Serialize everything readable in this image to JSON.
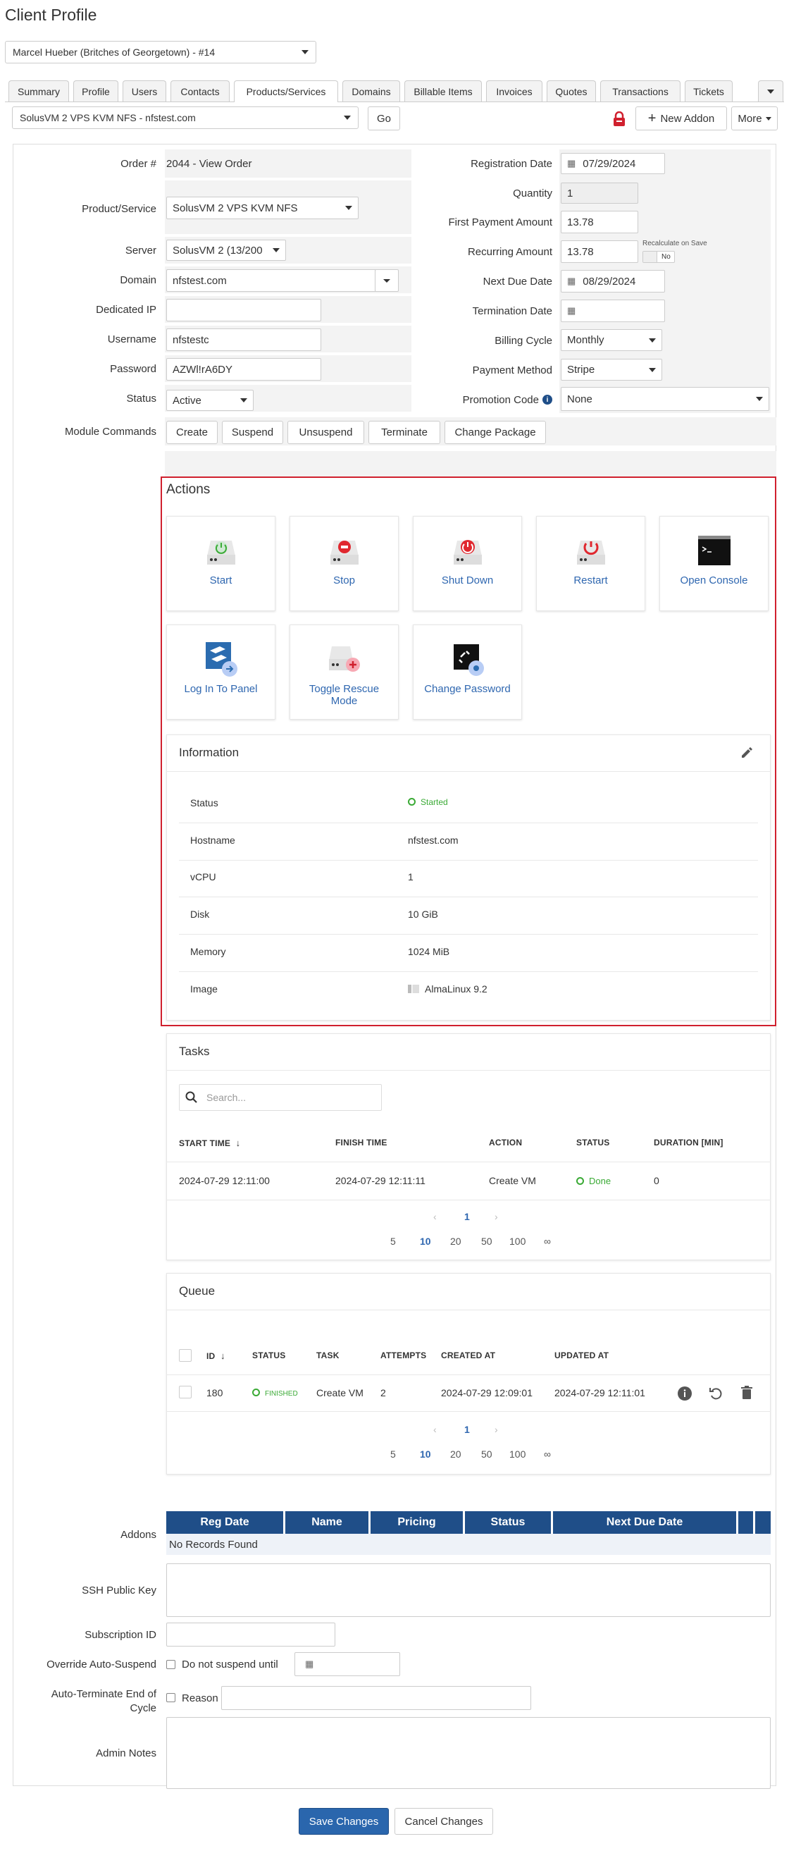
{
  "page_title": "Client Profile",
  "client_select": "Marcel Hueber (Britches of Georgetown) - #14",
  "tabs": [
    "Summary",
    "Profile",
    "Users",
    "Contacts",
    "Products/Services",
    "Domains",
    "Billable Items",
    "Invoices",
    "Quotes",
    "Transactions",
    "Tickets"
  ],
  "product_select": "SolusVM 2 VPS KVM NFS - nfstest.com",
  "go_label": "Go",
  "new_addon_label": "New Addon",
  "more_label": "More",
  "form": {
    "order_label": "Order #",
    "order_value": "2044 - View Order",
    "product_label": "Product/Service",
    "product_value": "SolusVM 2 VPS KVM NFS",
    "server_label": "Server",
    "server_value": "SolusVM 2 (13/200",
    "domain_label": "Domain",
    "domain_value": "nfstest.com",
    "dedicated_ip_label": "Dedicated IP",
    "username_label": "Username",
    "username_value": "nfstestc",
    "password_label": "Password",
    "password_value": "AZWl!rA6DY",
    "status_label": "Status",
    "status_value": "Active",
    "module_label": "Module Commands",
    "module_cmds": [
      "Create",
      "Suspend",
      "Unsuspend",
      "Terminate",
      "Change Package"
    ],
    "reg_date_label": "Registration Date",
    "reg_date_value": "07/29/2024",
    "quantity_label": "Quantity",
    "quantity_value": "1",
    "first_payment_label": "First Payment Amount",
    "first_payment_value": "13.78",
    "recurring_label": "Recurring Amount",
    "recurring_value": "13.78",
    "recalc_label": "Recalculate on Save",
    "recalc_toggle": "No",
    "next_due_label": "Next Due Date",
    "next_due_value": "08/29/2024",
    "termination_label": "Termination Date",
    "billing_label": "Billing Cycle",
    "billing_value": "Monthly",
    "payment_label": "Payment Method",
    "payment_value": "Stripe",
    "promo_label": "Promotion Code",
    "promo_value": "None"
  },
  "actions": {
    "title": "Actions",
    "buttons": [
      "Start",
      "Stop",
      "Shut Down",
      "Restart",
      "Open Console",
      "Log In To Panel",
      "Toggle Rescue Mode",
      "Change Password"
    ]
  },
  "information": {
    "title": "Information",
    "rows": [
      {
        "label": "Status",
        "value": "Started"
      },
      {
        "label": "Hostname",
        "value": "nfstest.com"
      },
      {
        "label": "vCPU",
        "value": "1"
      },
      {
        "label": "Disk",
        "value": "10 GiB"
      },
      {
        "label": "Memory",
        "value": "1024 MiB"
      },
      {
        "label": "Image",
        "value": "AlmaLinux 9.2"
      }
    ]
  },
  "tasks": {
    "title": "Tasks",
    "search_placeholder": "Search...",
    "headers": [
      "START TIME",
      "FINISH TIME",
      "ACTION",
      "STATUS",
      "DURATION [MIN]"
    ],
    "rows": [
      {
        "start": "2024-07-29 12:11:00",
        "finish": "2024-07-29 12:11:11",
        "action": "Create VM",
        "status": "Done",
        "duration": "0"
      }
    ],
    "page": "1",
    "page_sizes": [
      "5",
      "10",
      "20",
      "50",
      "100",
      "∞"
    ]
  },
  "queue": {
    "title": "Queue",
    "headers": [
      "ID",
      "STATUS",
      "TASK",
      "ATTEMPTS",
      "CREATED AT",
      "UPDATED AT"
    ],
    "rows": [
      {
        "id": "180",
        "status": "FINISHED",
        "task": "Create VM",
        "attempts": "2",
        "created": "2024-07-29 12:09:01",
        "updated": "2024-07-29 12:11:01"
      }
    ],
    "page": "1",
    "page_sizes": [
      "5",
      "10",
      "20",
      "50",
      "100",
      "∞"
    ]
  },
  "addons": {
    "label": "Addons",
    "headers": [
      "Reg Date",
      "Name",
      "Pricing",
      "Status",
      "Next Due Date"
    ],
    "empty": "No Records Found"
  },
  "ssh_label": "SSH Public Key",
  "subscription_label": "Subscription ID",
  "override_label": "Override Auto-Suspend",
  "override_check": "Do not suspend until",
  "autoterm_label_1": "Auto-Terminate End of",
  "autoterm_label_2": "Cycle",
  "reason_label": "Reason",
  "notes_label": "Admin Notes",
  "save_label": "Save Changes",
  "cancel_label": "Cancel Changes",
  "colors": {
    "link": "#2f67b0",
    "primary": "#2a66ad",
    "header": "#1f4e88",
    "highlight": "#d0202e",
    "success": "#3aaa35"
  }
}
